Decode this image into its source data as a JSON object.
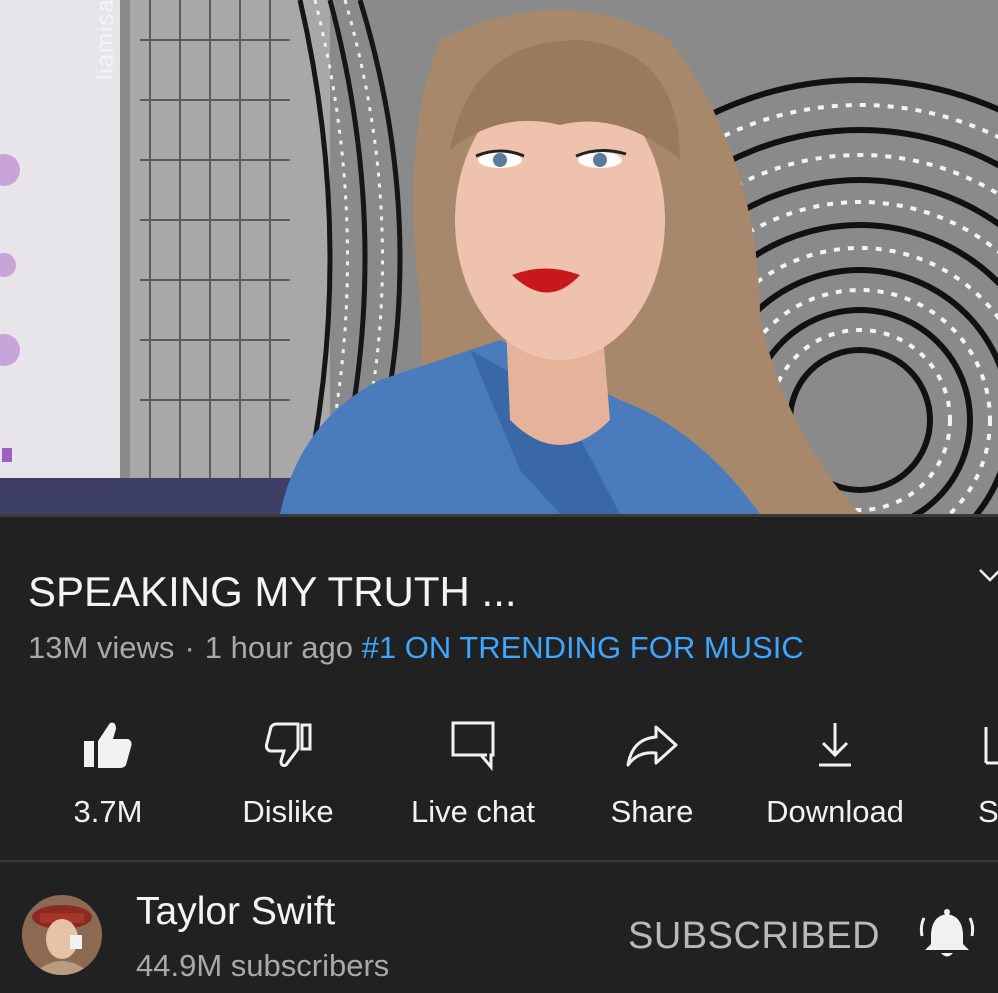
{
  "video": {
    "watermark": "liamisaswiftie",
    "progress_fraction": 0.0
  },
  "title": "SPEAKING MY TRUTH ...",
  "meta": {
    "views": "13M views",
    "separator": "·",
    "time": "1 hour ago",
    "trending": "#1 ON TRENDING FOR MUSIC"
  },
  "actions": {
    "like": "3.7M",
    "dislike": "Dislike",
    "live_chat": "Live chat",
    "share": "Share",
    "download": "Download",
    "save_partial": "S"
  },
  "channel": {
    "name": "Taylor Swift",
    "subscribers": "44.9M subscribers",
    "subscribed_label": "SUBSCRIBED"
  },
  "colors": {
    "background": "#212121",
    "accent_link": "#3ea6ff",
    "secondary_text": "#a9a9a9",
    "progress": "#ff0000"
  },
  "icons": {
    "like": "thumbs-up-filled-icon",
    "dislike": "thumbs-down-outline-icon",
    "live_chat": "chat-bubble-icon",
    "share": "share-arrow-icon",
    "download": "download-arrow-icon",
    "expand": "chevron-down-icon",
    "bell": "bell-ringing-icon"
  }
}
